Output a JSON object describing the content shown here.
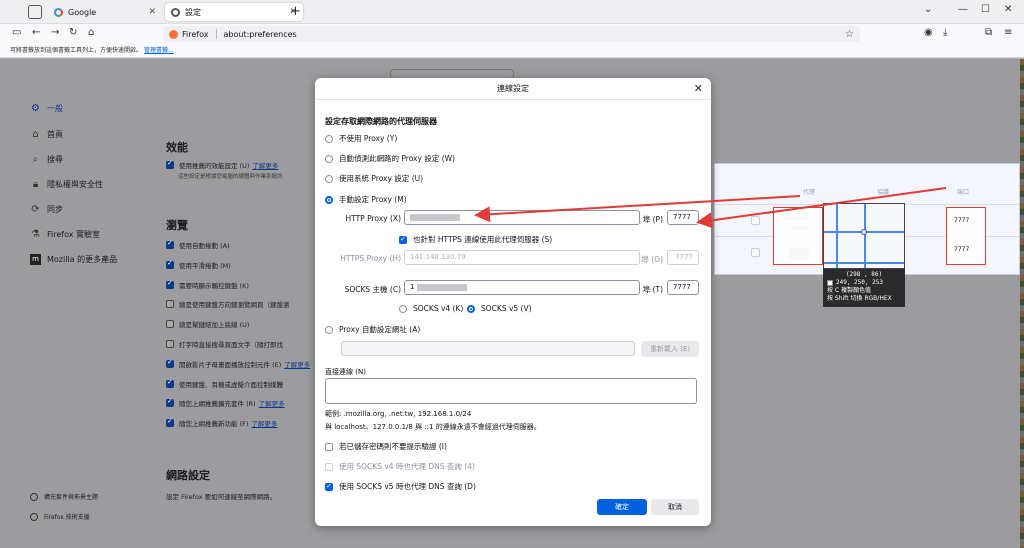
{
  "tabs": [
    {
      "title": "Google",
      "favicon": "google-icon"
    },
    {
      "title": "設定",
      "favicon": "gear-icon"
    }
  ],
  "urlbar": {
    "brand": "Firefox",
    "url": "about:preferences"
  },
  "bookmarks_bar": {
    "text": "可將書籤放到這個書籤工具列上，方便快速開啟。",
    "link": "管理書籤..."
  },
  "sidebar": {
    "items": [
      {
        "label": "一般",
        "icon": "gear-icon"
      },
      {
        "label": "首頁",
        "icon": "home-icon"
      },
      {
        "label": "搜尋",
        "icon": "search-icon"
      },
      {
        "label": "隱私權與安全性",
        "icon": "lock-icon"
      },
      {
        "label": "同步",
        "icon": "sync-icon"
      },
      {
        "label": "Firefox 實驗室",
        "icon": "flask-icon"
      },
      {
        "label": "Mozilla 的更多產品",
        "icon": "mozilla-icon"
      }
    ],
    "footer": [
      {
        "label": "擴充套件與佈景主題"
      },
      {
        "label": "Firefox 技術支援"
      }
    ]
  },
  "prefs": {
    "performance_title": "效能",
    "performance_opt": "使用推薦的效能設定 (U)",
    "learn_more": "了解更多",
    "performance_desc": "這些設定是根據您電腦的硬體與作業系統所",
    "browsing_title": "瀏覽",
    "browsing_opts": [
      "使用自動捲動 (A)",
      "使用平滑捲動 (M)",
      "需要時顯示觸控鍵盤 (K)",
      "總是使用鍵盤方向鍵瀏覽網頁（鍵盤瀏",
      "總是幫鏈結加上底線 (U)",
      "打字時直接搜尋頁面文字（隨打即找",
      "開啟影片子母畫面播放控制元件 (E)",
      "使用鍵盤、耳機或虛擬介面控制媒體",
      "隨您上網推薦擴充套件 (R)",
      "隨您上網推薦新功能 (F)"
    ],
    "network_title": "網路設定",
    "network_desc": "設定 Firefox 要如何連線至網際網路。"
  },
  "dialog": {
    "title": "連線設定",
    "heading": "設定存取網際網路的代理伺服器",
    "modes": [
      "不使用 Proxy (Y)",
      "自動偵測此網路的 Proxy 設定 (W)",
      "使用系統 Proxy 設定 (U)",
      "手動設定 Proxy (M)"
    ],
    "http_label": "HTTP Proxy (X)",
    "port_p": "埠 (P)",
    "http_port": "7777",
    "also_https": "也針對 HTTPS 連線使用此代理伺服器 (S)",
    "https_label": "HTTPS Proxy (H)",
    "https_value": "141.148.130.79",
    "port_o": "埠 (O)",
    "https_port": "7777",
    "socks_label": "SOCKS 主機 (C)",
    "socks_value": "1",
    "port_t": "埠 (T)",
    "socks_port": "7777",
    "socks_v4": "SOCKS v4 (K)",
    "socks_v5": "SOCKS v5 (V)",
    "pac_label": "Proxy 自動設定網址 (A)",
    "reload": "重新載入 (E)",
    "no_proxy_label": "直接連線 (N)",
    "example": "範例: .mozilla.org, .net.tw, 192.168.1.0/24",
    "localhost_note": "與 localhost、127.0.0.1/8 與 ::1 的連線永遠不會經過代理伺服器。",
    "opt_no_auth": "若已儲存密碼則不要提示驗證 (I)",
    "opt_socks4_dns": "使用 SOCKS v4 時也代理 DNS 查詢 (4)",
    "opt_socks5_dns": "使用 SOCKS v5 時也代理 DNS 查詢 (D)",
    "ok": "確定",
    "cancel": "取消"
  },
  "zoom_overlay": {
    "col_proxy": "代理",
    "col_protocol": "協議",
    "col_port": "端口",
    "port_values": [
      "7777",
      "7777"
    ],
    "coords": "(298 , 86)",
    "rgb": "249, 250, 253",
    "hint_copy_key": "C",
    "hint_copy": "按 C 複製顏色值",
    "hint_switch_key": "Shift",
    "hint_switch": "按 Shift 切換 RGB/HEX"
  },
  "colors": {
    "accent": "#0061e0",
    "arrow": "#e53935",
    "chip": "#f9fafd"
  }
}
